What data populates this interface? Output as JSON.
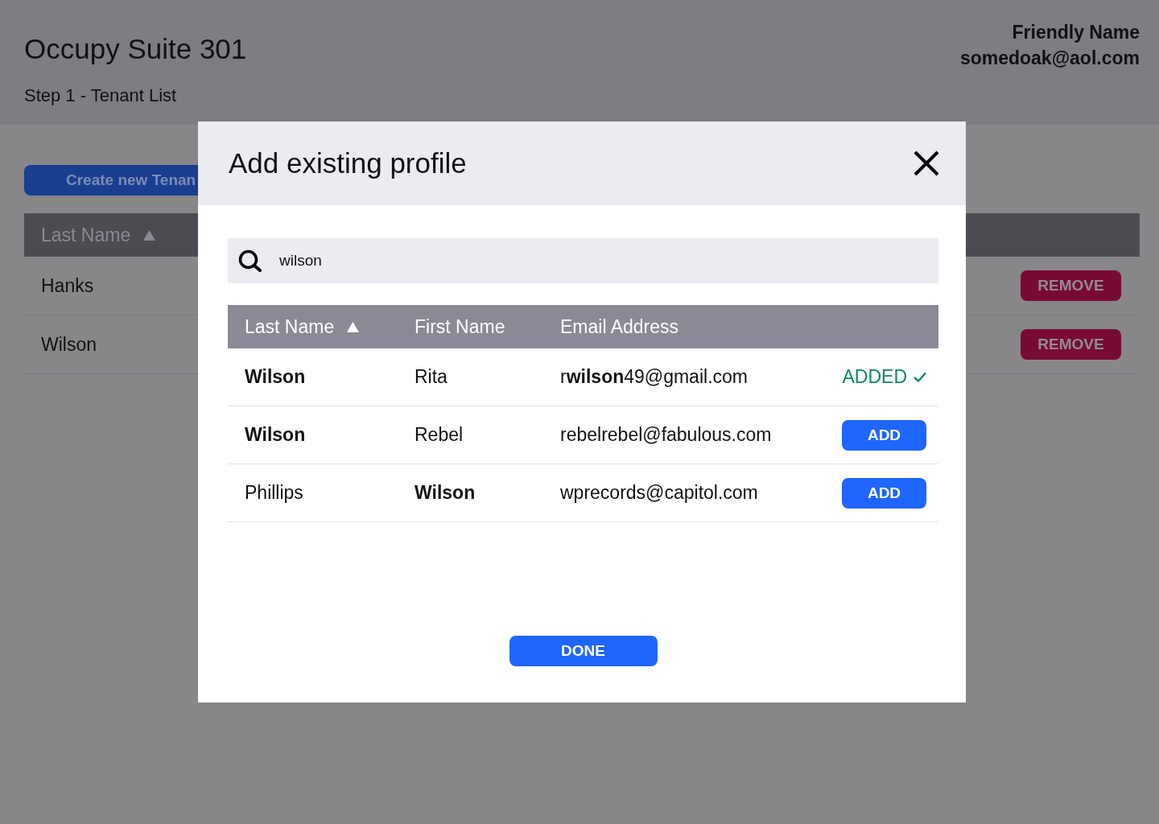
{
  "page": {
    "title": "Occupy Suite 301",
    "step": "Step 1 - Tenant List"
  },
  "user": {
    "name": "Friendly Name",
    "email": "somedoak@aol.com"
  },
  "create_button": "Create new Tenan",
  "tenant_table": {
    "columns": [
      {
        "label": "Last Name",
        "sorted_ascending": true
      }
    ],
    "rows": [
      {
        "last_name": "Hanks",
        "action": "REMOVE"
      },
      {
        "last_name": "Wilson",
        "action": "REMOVE"
      }
    ]
  },
  "modal": {
    "title": "Add existing profile",
    "search": {
      "value": "wilson"
    },
    "columns": [
      {
        "label": "Last Name",
        "sorted_ascending": true
      },
      {
        "label": "First Name"
      },
      {
        "label": "Email Address"
      }
    ],
    "rows": [
      {
        "last_name": {
          "text": "Wilson",
          "match": true
        },
        "first_name": {
          "text": "Rita",
          "match": false
        },
        "email": "r**wilson**49@gmail.com",
        "action": {
          "kind": "status",
          "label": "ADDED"
        }
      },
      {
        "last_name": {
          "text": "Wilson",
          "match": true
        },
        "first_name": {
          "text": "Rebel",
          "match": false
        },
        "email": "rebelrebel@fabulous.com",
        "action": {
          "kind": "button",
          "label": "ADD"
        }
      },
      {
        "last_name": {
          "text": "Phillips",
          "match": false
        },
        "first_name": {
          "text": "Wilson",
          "match": true
        },
        "email": "wprecords@capitol.com",
        "action": {
          "kind": "button",
          "label": "ADD"
        }
      }
    ],
    "done_button": "DONE"
  }
}
